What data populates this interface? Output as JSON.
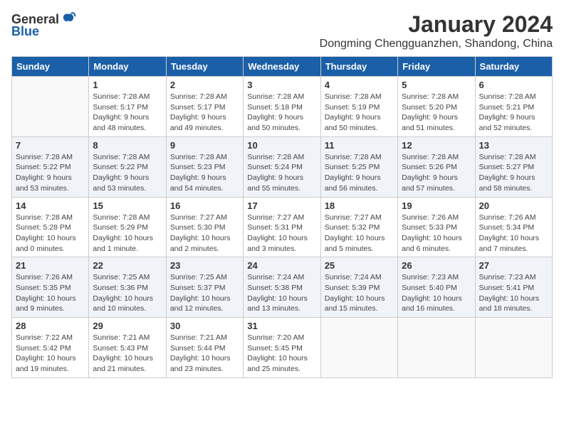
{
  "logo": {
    "general": "General",
    "blue": "Blue"
  },
  "title": "January 2024",
  "subtitle": "Dongming Chengguanzhen, Shandong, China",
  "weekdays": [
    "Sunday",
    "Monday",
    "Tuesday",
    "Wednesday",
    "Thursday",
    "Friday",
    "Saturday"
  ],
  "weeks": [
    [
      {
        "day": "",
        "sunrise": "",
        "sunset": "",
        "daylight": ""
      },
      {
        "day": "1",
        "sunrise": "Sunrise: 7:28 AM",
        "sunset": "Sunset: 5:17 PM",
        "daylight": "Daylight: 9 hours and 48 minutes."
      },
      {
        "day": "2",
        "sunrise": "Sunrise: 7:28 AM",
        "sunset": "Sunset: 5:17 PM",
        "daylight": "Daylight: 9 hours and 49 minutes."
      },
      {
        "day": "3",
        "sunrise": "Sunrise: 7:28 AM",
        "sunset": "Sunset: 5:18 PM",
        "daylight": "Daylight: 9 hours and 50 minutes."
      },
      {
        "day": "4",
        "sunrise": "Sunrise: 7:28 AM",
        "sunset": "Sunset: 5:19 PM",
        "daylight": "Daylight: 9 hours and 50 minutes."
      },
      {
        "day": "5",
        "sunrise": "Sunrise: 7:28 AM",
        "sunset": "Sunset: 5:20 PM",
        "daylight": "Daylight: 9 hours and 51 minutes."
      },
      {
        "day": "6",
        "sunrise": "Sunrise: 7:28 AM",
        "sunset": "Sunset: 5:21 PM",
        "daylight": "Daylight: 9 hours and 52 minutes."
      }
    ],
    [
      {
        "day": "7",
        "sunrise": "Sunrise: 7:28 AM",
        "sunset": "Sunset: 5:22 PM",
        "daylight": "Daylight: 9 hours and 53 minutes."
      },
      {
        "day": "8",
        "sunrise": "Sunrise: 7:28 AM",
        "sunset": "Sunset: 5:22 PM",
        "daylight": "Daylight: 9 hours and 53 minutes."
      },
      {
        "day": "9",
        "sunrise": "Sunrise: 7:28 AM",
        "sunset": "Sunset: 5:23 PM",
        "daylight": "Daylight: 9 hours and 54 minutes."
      },
      {
        "day": "10",
        "sunrise": "Sunrise: 7:28 AM",
        "sunset": "Sunset: 5:24 PM",
        "daylight": "Daylight: 9 hours and 55 minutes."
      },
      {
        "day": "11",
        "sunrise": "Sunrise: 7:28 AM",
        "sunset": "Sunset: 5:25 PM",
        "daylight": "Daylight: 9 hours and 56 minutes."
      },
      {
        "day": "12",
        "sunrise": "Sunrise: 7:28 AM",
        "sunset": "Sunset: 5:26 PM",
        "daylight": "Daylight: 9 hours and 57 minutes."
      },
      {
        "day": "13",
        "sunrise": "Sunrise: 7:28 AM",
        "sunset": "Sunset: 5:27 PM",
        "daylight": "Daylight: 9 hours and 58 minutes."
      }
    ],
    [
      {
        "day": "14",
        "sunrise": "Sunrise: 7:28 AM",
        "sunset": "Sunset: 5:28 PM",
        "daylight": "Daylight: 10 hours and 0 minutes."
      },
      {
        "day": "15",
        "sunrise": "Sunrise: 7:28 AM",
        "sunset": "Sunset: 5:29 PM",
        "daylight": "Daylight: 10 hours and 1 minute."
      },
      {
        "day": "16",
        "sunrise": "Sunrise: 7:27 AM",
        "sunset": "Sunset: 5:30 PM",
        "daylight": "Daylight: 10 hours and 2 minutes."
      },
      {
        "day": "17",
        "sunrise": "Sunrise: 7:27 AM",
        "sunset": "Sunset: 5:31 PM",
        "daylight": "Daylight: 10 hours and 3 minutes."
      },
      {
        "day": "18",
        "sunrise": "Sunrise: 7:27 AM",
        "sunset": "Sunset: 5:32 PM",
        "daylight": "Daylight: 10 hours and 5 minutes."
      },
      {
        "day": "19",
        "sunrise": "Sunrise: 7:26 AM",
        "sunset": "Sunset: 5:33 PM",
        "daylight": "Daylight: 10 hours and 6 minutes."
      },
      {
        "day": "20",
        "sunrise": "Sunrise: 7:26 AM",
        "sunset": "Sunset: 5:34 PM",
        "daylight": "Daylight: 10 hours and 7 minutes."
      }
    ],
    [
      {
        "day": "21",
        "sunrise": "Sunrise: 7:26 AM",
        "sunset": "Sunset: 5:35 PM",
        "daylight": "Daylight: 10 hours and 9 minutes."
      },
      {
        "day": "22",
        "sunrise": "Sunrise: 7:25 AM",
        "sunset": "Sunset: 5:36 PM",
        "daylight": "Daylight: 10 hours and 10 minutes."
      },
      {
        "day": "23",
        "sunrise": "Sunrise: 7:25 AM",
        "sunset": "Sunset: 5:37 PM",
        "daylight": "Daylight: 10 hours and 12 minutes."
      },
      {
        "day": "24",
        "sunrise": "Sunrise: 7:24 AM",
        "sunset": "Sunset: 5:38 PM",
        "daylight": "Daylight: 10 hours and 13 minutes."
      },
      {
        "day": "25",
        "sunrise": "Sunrise: 7:24 AM",
        "sunset": "Sunset: 5:39 PM",
        "daylight": "Daylight: 10 hours and 15 minutes."
      },
      {
        "day": "26",
        "sunrise": "Sunrise: 7:23 AM",
        "sunset": "Sunset: 5:40 PM",
        "daylight": "Daylight: 10 hours and 16 minutes."
      },
      {
        "day": "27",
        "sunrise": "Sunrise: 7:23 AM",
        "sunset": "Sunset: 5:41 PM",
        "daylight": "Daylight: 10 hours and 18 minutes."
      }
    ],
    [
      {
        "day": "28",
        "sunrise": "Sunrise: 7:22 AM",
        "sunset": "Sunset: 5:42 PM",
        "daylight": "Daylight: 10 hours and 19 minutes."
      },
      {
        "day": "29",
        "sunrise": "Sunrise: 7:21 AM",
        "sunset": "Sunset: 5:43 PM",
        "daylight": "Daylight: 10 hours and 21 minutes."
      },
      {
        "day": "30",
        "sunrise": "Sunrise: 7:21 AM",
        "sunset": "Sunset: 5:44 PM",
        "daylight": "Daylight: 10 hours and 23 minutes."
      },
      {
        "day": "31",
        "sunrise": "Sunrise: 7:20 AM",
        "sunset": "Sunset: 5:45 PM",
        "daylight": "Daylight: 10 hours and 25 minutes."
      },
      {
        "day": "",
        "sunrise": "",
        "sunset": "",
        "daylight": ""
      },
      {
        "day": "",
        "sunrise": "",
        "sunset": "",
        "daylight": ""
      },
      {
        "day": "",
        "sunrise": "",
        "sunset": "",
        "daylight": ""
      }
    ]
  ]
}
